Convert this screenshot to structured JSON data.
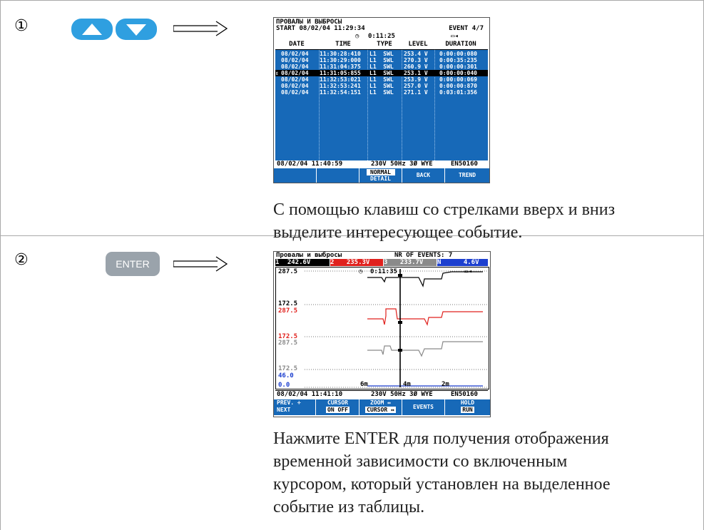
{
  "steps": [
    {
      "number": "①",
      "screen": {
        "title": "ПРОВАЛЫ И ВЫБРОСЫ",
        "start": "START 08/02/04  11:29:34",
        "event": "EVENT  4/7",
        "clock": "0:11:25",
        "columns": [
          "DATE",
          "TIME",
          "TYPE",
          "LEVEL",
          "DURATION"
        ],
        "rows": [
          [
            "08/02/04",
            "11:30:28:410",
            "L1  SWL",
            "253.4 V",
            "0:00:00:080"
          ],
          [
            "08/02/04",
            "11:30:29:000",
            "L1  SWL",
            "270.3 V",
            "0:00:35:235"
          ],
          [
            "08/02/04",
            "11:31:04:375",
            "L1  SWL",
            "260.9 V",
            "0:00:00:301"
          ],
          [
            "08/02/04",
            "11:31:05:855",
            "L1  SWL",
            "253.1 V",
            "0:00:00:040"
          ],
          [
            "08/02/04",
            "11:32:53:021",
            "L1  SWL",
            "253.9 V",
            "0:00:00:069"
          ],
          [
            "08/02/04",
            "11:32:53:241",
            "L1  SWL",
            "257.0 V",
            "0:00:00:870"
          ],
          [
            "08/02/04",
            "11:32:54:151",
            "L1  SWL",
            "271.1 V",
            "0:03:01:356"
          ]
        ],
        "selected_row": 3,
        "footer": {
          "datetime": "08/02/04  11:40:59",
          "nominal": "230V  50Hz 3Ø WYE",
          "standard": "EN50160"
        },
        "fkeys": [
          "",
          "",
          "NORMAL\nDETAIL",
          "BACK",
          "TREND"
        ]
      },
      "description": "С помощью клавиш со стрелками вверх и вниз выделите интересующее событие.",
      "description_lines": [
        "С помощью клавиш со стрелками вверх и вниз",
        "выделите интересующее событие."
      ]
    },
    {
      "number": "②",
      "key_label": "ENTER",
      "screen": {
        "title": "Провалы и выбросы",
        "nr_events": "NR OF EVENTS:  7",
        "channels": [
          {
            "num": "1",
            "value": "242.6V",
            "color": "#000000"
          },
          {
            "num": "2",
            "value": "235.3V",
            "color": "#e0211d"
          },
          {
            "num": "3",
            "value": "233.7V",
            "color": "#8a8a8a"
          },
          {
            "num": "N",
            "value": "4.6V",
            "color": "#1c3fcf"
          }
        ],
        "clock": "0:11:35",
        "scale_labels": [
          {
            "text": "287.5",
            "color": "#000000"
          },
          {
            "text": "172.5",
            "color": "#000000"
          },
          {
            "text": "287.5",
            "color": "#e0211d"
          },
          {
            "text": "172.5",
            "color": "#e0211d"
          },
          {
            "text": "287.5",
            "color": "#8a8a8a"
          },
          {
            "text": "172.5",
            "color": "#8a8a8a"
          },
          {
            "text": "46.0",
            "color": "#1c3fcf"
          },
          {
            "text": "0.0",
            "color": "#1c3fcf"
          }
        ],
        "time_labels": [
          "6m",
          "4m",
          "2m"
        ],
        "footer": {
          "datetime": "08/02/04  11:41:10",
          "nominal": "230V  50Hz 3Ø WYE",
          "standard": "EN50160"
        },
        "fkeys": [
          {
            "line1": "PREV. ÷",
            "line2": "NEXT"
          },
          {
            "line1": "CURSOR",
            "line2": "ON OFF"
          },
          {
            "line1": "ZOOM ↔",
            "line2": "CURSOR ↔"
          },
          {
            "line1": "EVENTS",
            "line2": ""
          },
          {
            "line1": "HOLD",
            "line2": "RUN"
          }
        ]
      },
      "description_lines": [
        "Нажмите ENTER для получения отображения",
        "временной зависимости со включенным",
        "курсором, который установлен на выделенное",
        "событие из таблицы."
      ]
    }
  ],
  "colors": {
    "screen_blue": "#1769b8",
    "key_blue": "#2f9fe0",
    "key_gray": "#9aa3ab"
  }
}
